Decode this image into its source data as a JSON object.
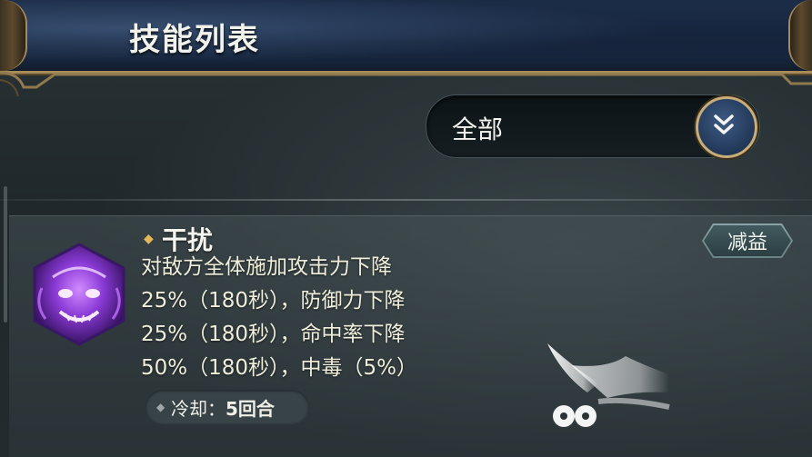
{
  "header": {
    "title": "技能列表"
  },
  "filter": {
    "selected": "全部",
    "icon": "double-chevron-down-icon"
  },
  "skill": {
    "name": "干扰",
    "tag": "减益",
    "description_lines": [
      "对敌方全体施加攻击力下降",
      "25%（180秒），防御力下降",
      "25%（180秒），命中率下降",
      "50%（180秒），中毒（5%）"
    ],
    "cooldown_label": "冷却：",
    "cooldown_value": "5回合",
    "icon": "purple-demon-skill-icon"
  },
  "colors": {
    "title_bar": "#15233b",
    "gold_trim": "#a68b59",
    "text": "#f2f2ec",
    "accent_diamond": "#e3b858",
    "skill_glow": "#8a3ad6"
  }
}
